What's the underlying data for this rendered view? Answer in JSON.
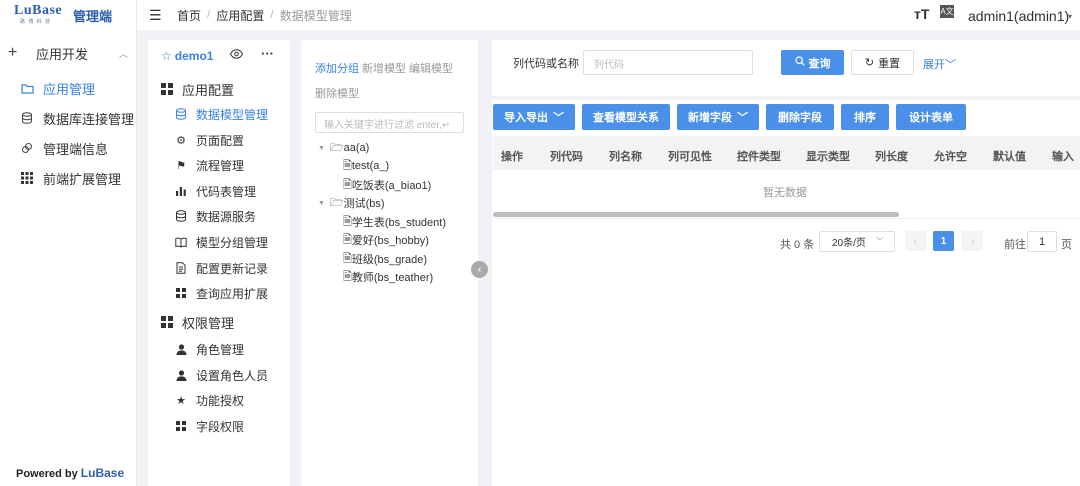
{
  "colors": {
    "primary": "#4a90e8",
    "active_text": "#3a80e8",
    "brand": "#2d5fb0"
  },
  "leftnav": {
    "logo_text": "LuBase",
    "logo_sub": "路 博 科 技",
    "brand": "管理端",
    "group": {
      "label": "应用开发",
      "icon": "plus-icon"
    },
    "items": [
      {
        "label": "应用管理",
        "icon": "folder-icon",
        "active": true
      },
      {
        "label": "数据库连接管理",
        "icon": "database-icon",
        "active": false
      },
      {
        "label": "管理端信息",
        "icon": "link-icon",
        "active": false
      },
      {
        "label": "前端扩展管理",
        "icon": "grid-icon",
        "active": false
      }
    ],
    "powered_prefix": "Powered by ",
    "powered_brand": "LuBase"
  },
  "topbar": {
    "breadcrumb": [
      "首页",
      "应用配置",
      "数据模型管理"
    ],
    "sep": "/",
    "text_size_icon": "тT",
    "translate_icon": "A文",
    "user": "admin1(admin1)"
  },
  "appnav": {
    "app_name": "demo1",
    "sections": [
      {
        "label": "应用配置",
        "items": [
          {
            "label": "数据模型管理",
            "icon": "database-icon",
            "active": true
          },
          {
            "label": "页面配置",
            "icon": "gear-icon"
          },
          {
            "label": "流程管理",
            "icon": "flag-icon"
          },
          {
            "label": "代码表管理",
            "icon": "bar-chart-icon"
          },
          {
            "label": "数据源服务",
            "icon": "database-icon"
          },
          {
            "label": "模型分组管理",
            "icon": "book-icon"
          },
          {
            "label": "配置更新记录",
            "icon": "document-icon"
          },
          {
            "label": "查询应用扩展",
            "icon": "grid-icon"
          }
        ]
      },
      {
        "label": "权限管理",
        "items": [
          {
            "label": "角色管理",
            "icon": "user-icon"
          },
          {
            "label": "设置角色人员",
            "icon": "user-icon"
          },
          {
            "label": "功能授权",
            "icon": "star-icon"
          },
          {
            "label": "字段权限",
            "icon": "grid-icon"
          }
        ]
      }
    ]
  },
  "tree": {
    "actions": [
      "添加分组",
      "新增模型",
      "编辑模型",
      "删除模型"
    ],
    "search_placeholder": "输入关键字进行过滤     enter,↵",
    "groups": [
      {
        "label": "aa(a)",
        "children": [
          "test(a_)",
          "吃饭表(a_biao1)"
        ]
      },
      {
        "label": "测试(bs)",
        "children": [
          "学生表(bs_student)",
          "爱好(bs_hobby)",
          "班级(bs_grade)",
          "教师(bs_teather)"
        ]
      }
    ]
  },
  "search": {
    "label": "列代码或名称",
    "placeholder": "列代码",
    "query_btn": "查询",
    "reset_btn": "重置",
    "expand": "展开"
  },
  "toolbar": {
    "buttons": [
      "导入导出",
      "查看模型关系",
      "新增字段",
      "删除字段",
      "排序",
      "设计表单"
    ]
  },
  "table": {
    "columns": [
      "操作",
      "列代码",
      "列名称",
      "列可见性",
      "控件类型",
      "显示类型",
      "列长度",
      "允许空",
      "默认值",
      "输入"
    ],
    "empty_text": "暂无数据"
  },
  "pagination": {
    "total": "共 0 条",
    "page_size": "20条/页",
    "current_page": "1",
    "goto_label": "前往",
    "goto_value": "1",
    "page_suffix": "页"
  }
}
